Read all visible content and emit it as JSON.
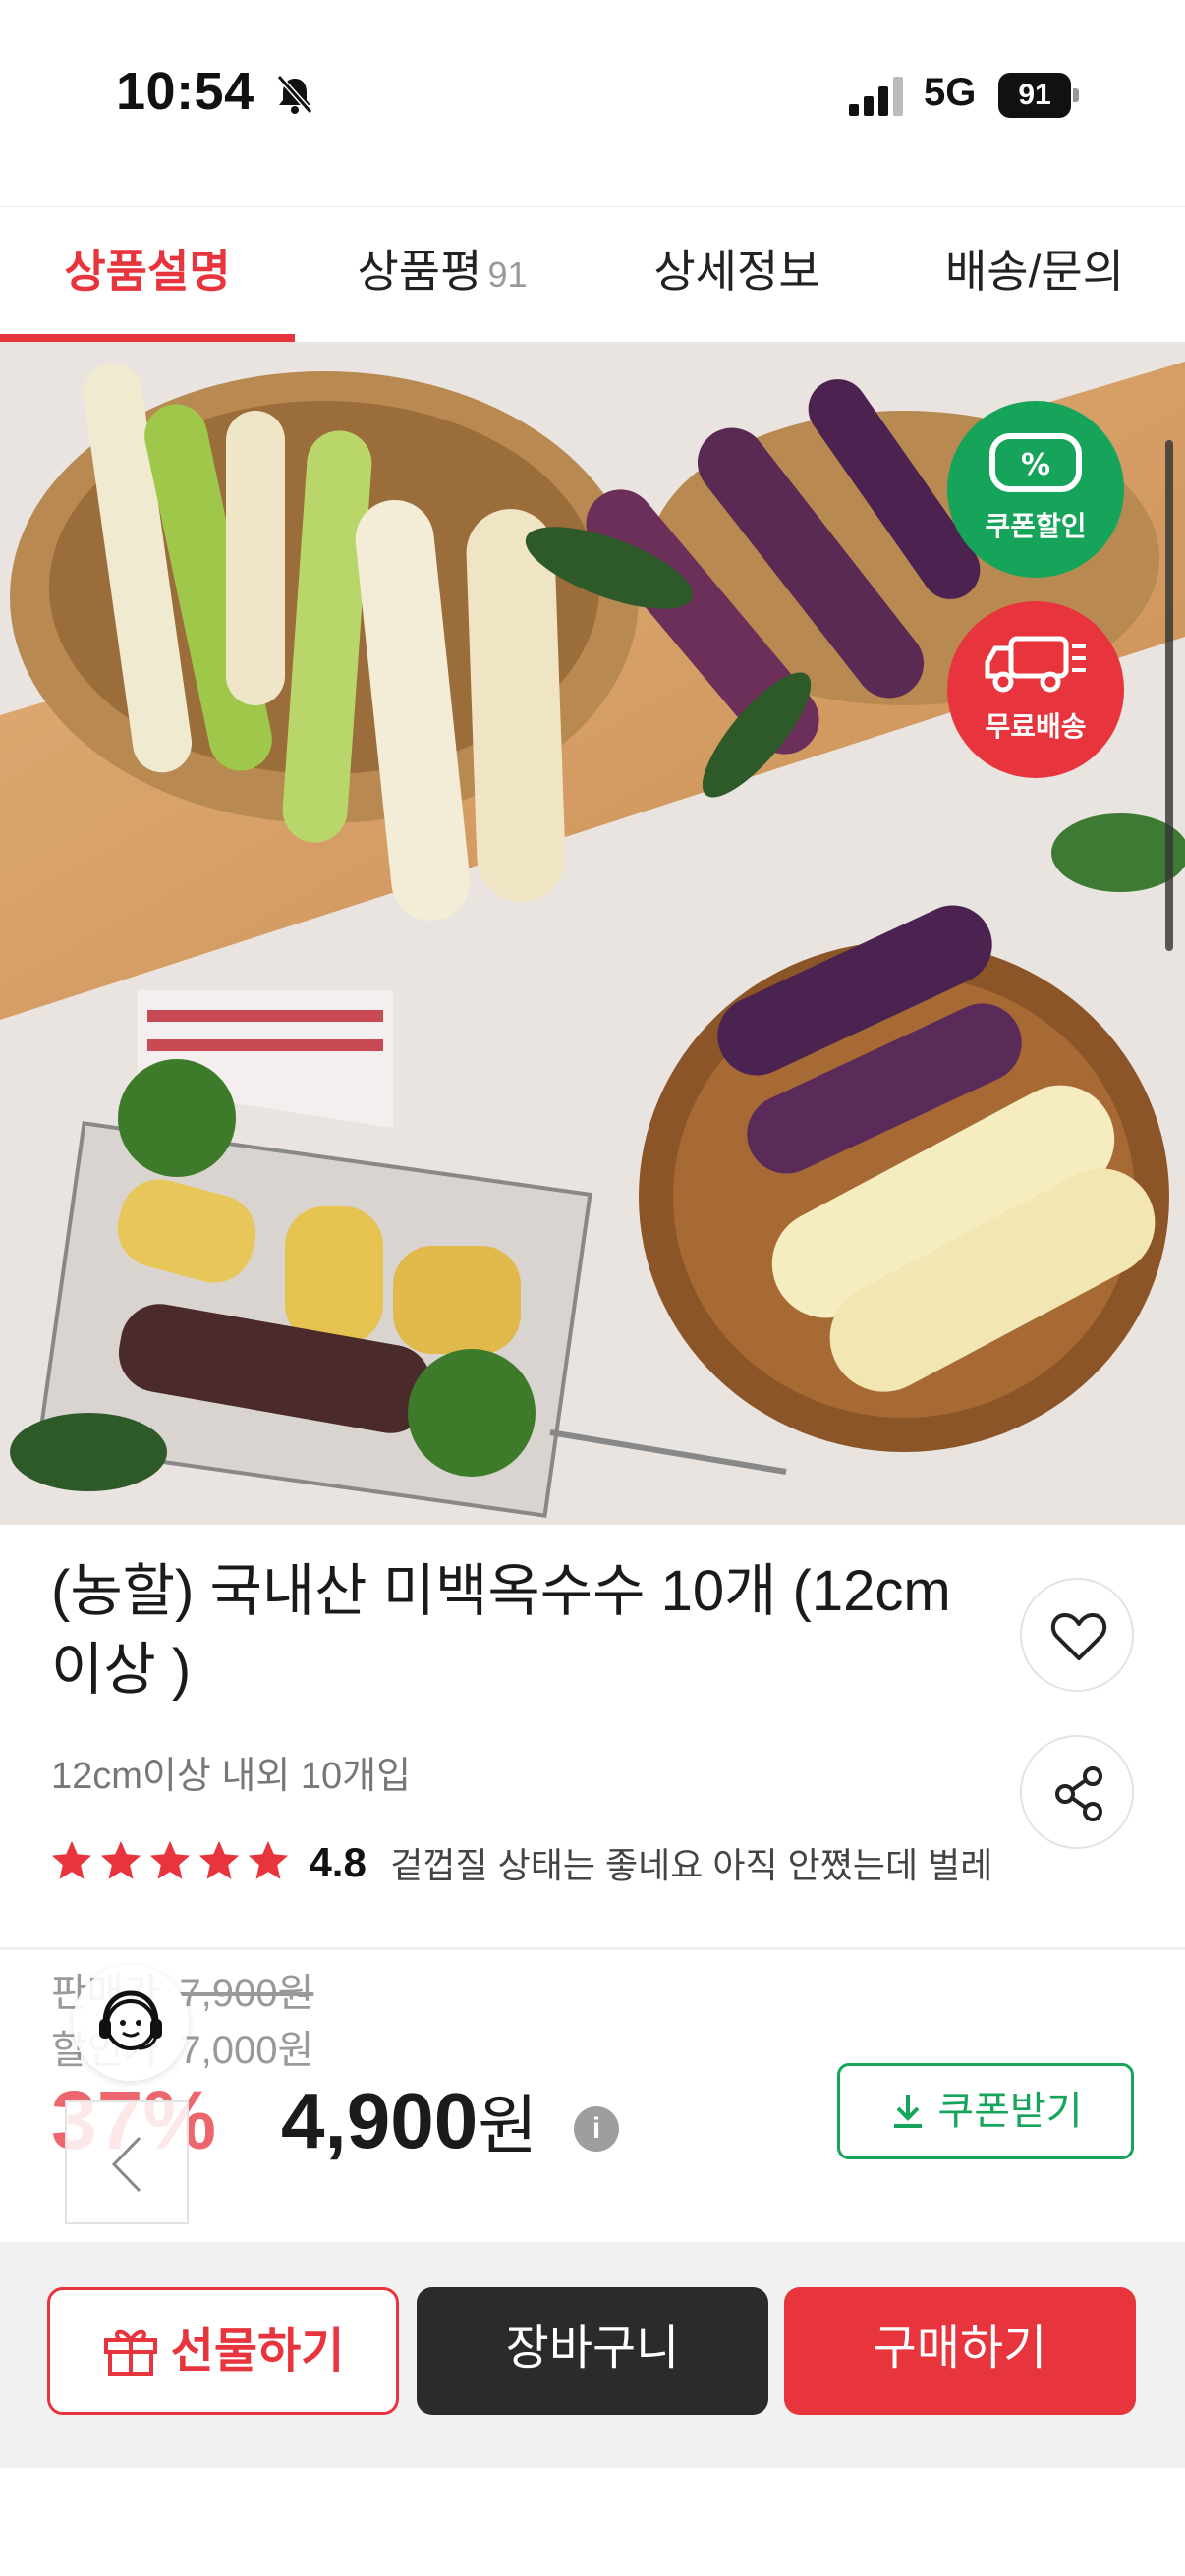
{
  "status_bar": {
    "time": "10:54",
    "network": "5G",
    "battery": "91"
  },
  "tabs": [
    {
      "label": "상품설명",
      "count": ""
    },
    {
      "label": "상품평",
      "count": "91"
    },
    {
      "label": "상세정보",
      "count": ""
    },
    {
      "label": "배송/문의",
      "count": ""
    }
  ],
  "image_badges": {
    "coupon": "쿠폰할인",
    "free_shipping": "무료배송"
  },
  "product": {
    "title": "(농할) 국내산 미백옥수수 10개 (12cm 이상 )",
    "subtitle": "12cm이상 내외 10개입",
    "rating": "4.8",
    "stars": 5,
    "review_snippet": "겉껍질 상태는 좋네요 아직 안쪘는데 벌레"
  },
  "price": {
    "original_label": "판매가",
    "original_value": "7,900원",
    "sale_label": "할인가",
    "sale_value": "7,000원",
    "discount_rate": "37%",
    "final_value": "4,900",
    "final_unit": "원",
    "info_icon": "i"
  },
  "coupon_button": "쿠폰받기",
  "bottom_bar": {
    "gift": "선물하기",
    "cart": "장바구니",
    "buy": "구매하기"
  },
  "colors": {
    "accent_red": "#e8343d",
    "accent_green": "#16a35a",
    "dark": "#2b2b2b"
  },
  "icons": [
    "bell-off-icon",
    "signal-icon",
    "battery-icon",
    "coupon-percent-icon",
    "truck-icon",
    "heart-icon",
    "share-icon",
    "star-icon",
    "info-icon",
    "download-icon",
    "headset-icon",
    "chevron-left-icon",
    "gift-icon"
  ]
}
